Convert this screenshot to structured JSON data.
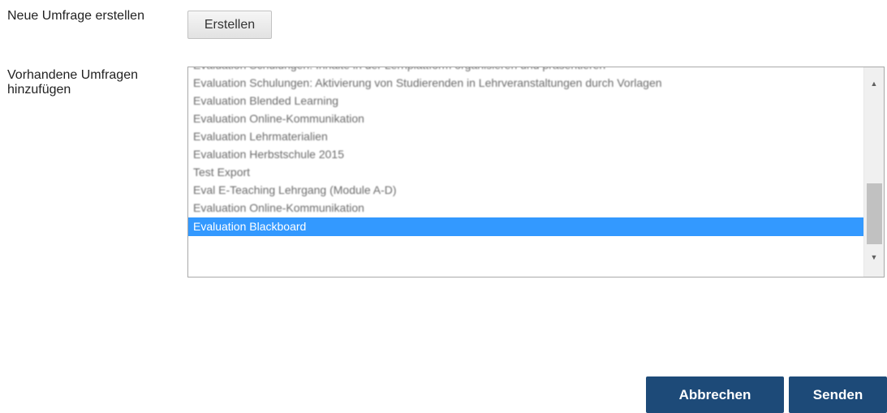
{
  "new_survey": {
    "label": "Neue Umfrage erstellen",
    "button_label": "Erstellen"
  },
  "existing_surveys": {
    "label": "Vorhandene Umfragen hinzufügen",
    "items": [
      {
        "label": "Evaluation Schulungen: Inhalte in der Lernplattform organisieren und präsentieren",
        "selected": false
      },
      {
        "label": "Evaluation Schulungen: Aktivierung von Studierenden in Lehrveranstaltungen durch Vorlagen",
        "selected": false
      },
      {
        "label": "Evaluation Blended Learning",
        "selected": false
      },
      {
        "label": "Evaluation Online-Kommunikation",
        "selected": false
      },
      {
        "label": "Evaluation Lehrmaterialien",
        "selected": false
      },
      {
        "label": "Evaluation Herbstschule 2015",
        "selected": false
      },
      {
        "label": "Test Export",
        "selected": false
      },
      {
        "label": "Eval E-Teaching Lehrgang (Module A-D)",
        "selected": false
      },
      {
        "label": "Evaluation Online-Kommunikation",
        "selected": false
      },
      {
        "label": "Evaluation Blackboard",
        "selected": true
      }
    ]
  },
  "actions": {
    "cancel_label": "Abbrechen",
    "submit_label": "Senden"
  },
  "colors": {
    "primary_button": "#1d4a78",
    "selection": "#3399ff"
  }
}
